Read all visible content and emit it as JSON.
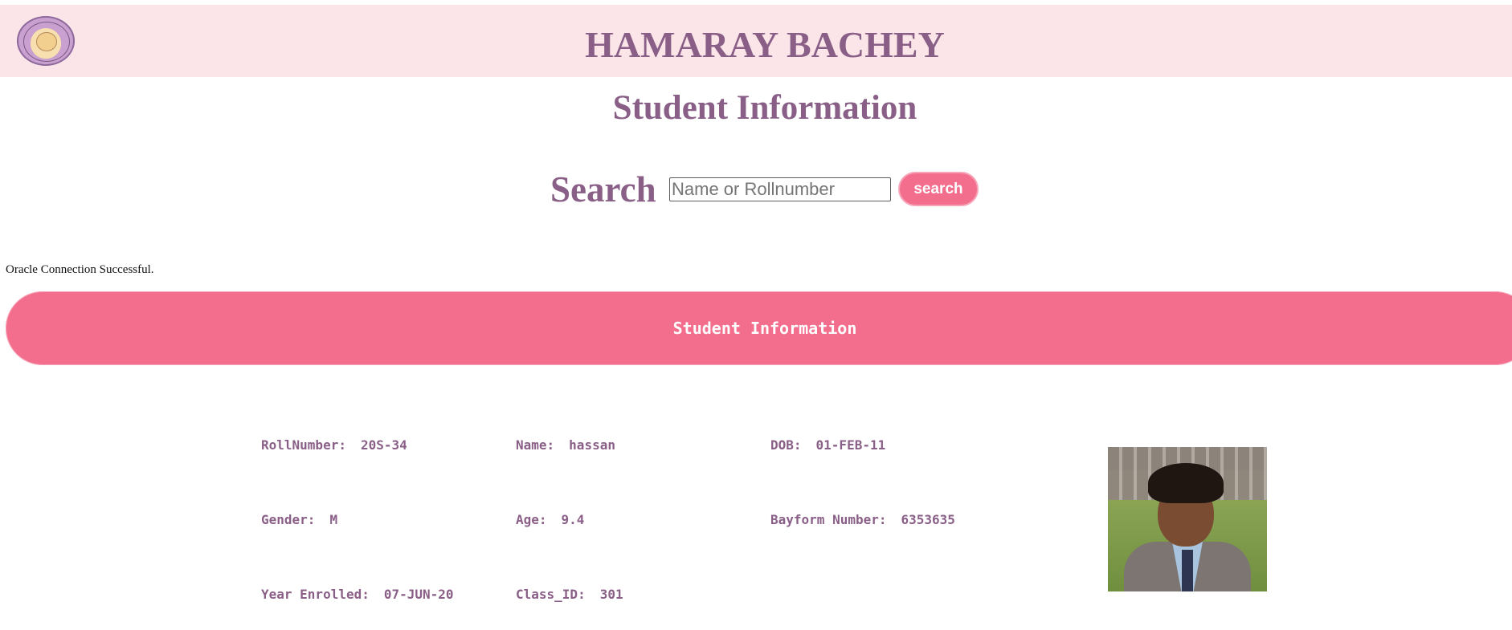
{
  "header": {
    "site_title": "HAMARAY BACHEY",
    "logo_icon": "school-crest-icon"
  },
  "page_heading": "Student Information",
  "search": {
    "label": "Search",
    "placeholder": "Name or Rollnumber",
    "value": "",
    "button_label": "search"
  },
  "status": {
    "message": "Oracle Connection Successful."
  },
  "student_section": {
    "title": "Student Information",
    "fields": {
      "roll_number": {
        "label": "RollNumber:",
        "value": "20S-34"
      },
      "name": {
        "label": "Name:",
        "value": "hassan"
      },
      "dob": {
        "label": "DOB:",
        "value": "01-FEB-11"
      },
      "gender": {
        "label": "Gender:",
        "value": "M"
      },
      "age": {
        "label": "Age:",
        "value": "9.4"
      },
      "bayform_number": {
        "label": "Bayform Number:",
        "value": "6353635"
      },
      "year_enrolled": {
        "label": "Year Enrolled:",
        "value": "07-JUN-20"
      },
      "class_id": {
        "label": "Class_ID:",
        "value": "301"
      }
    },
    "photo_icon": "student-photo"
  },
  "colors": {
    "header_bg": "#fbe5e9",
    "heading_text": "#8a5f87",
    "accent_pink": "#f36d8d",
    "field_text": "#8a5f87"
  }
}
